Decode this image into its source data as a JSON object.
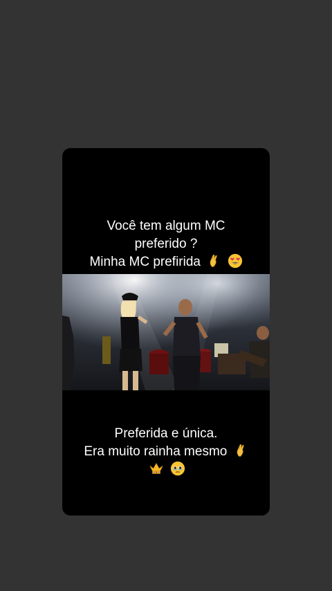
{
  "post": {
    "top_caption": {
      "line1": "Você tem algum MC",
      "line2": "preferido ?",
      "line3": "Minha MC prefirida"
    },
    "bottom_caption": {
      "line1": "Preferida e única.",
      "line2": "Era muito rainha mesmo"
    },
    "icons": {
      "top_line3": [
        "pinched-fingers-icon",
        "heart-eyes-icon"
      ],
      "bottom_line2": [
        "pinched-fingers-icon"
      ],
      "bottom_line3": [
        "crown-icon",
        "teary-face-icon"
      ]
    },
    "video": {
      "scene": "concert-stage"
    }
  },
  "colors": {
    "background": "#333333",
    "card": "#000000",
    "text": "#ffffff"
  }
}
